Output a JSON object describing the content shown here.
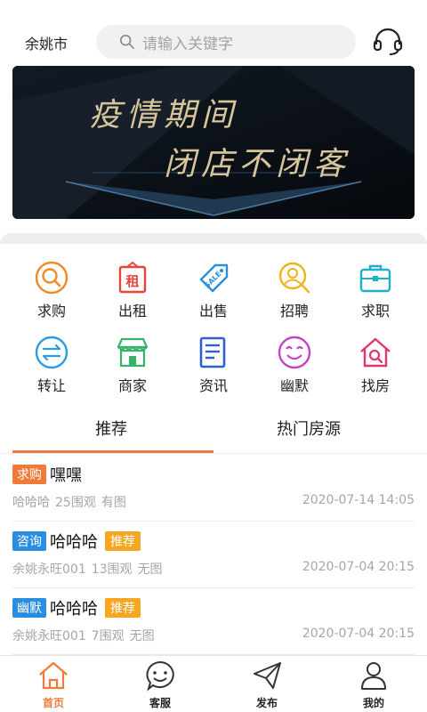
{
  "header": {
    "city": "余姚市",
    "search_placeholder": "请输入关键字"
  },
  "banner": {
    "line1": "疫情期间",
    "line2": "闭店不闭客"
  },
  "categories": [
    {
      "label": "求购",
      "icon": "magnifier-circle-icon",
      "color": "#f08a24"
    },
    {
      "label": "出租",
      "icon": "rent-sign-icon",
      "color": "#e8443a"
    },
    {
      "label": "出售",
      "icon": "sale-tag-icon",
      "color": "#2a8ee0"
    },
    {
      "label": "招聘",
      "icon": "person-search-icon",
      "color": "#f2b21b"
    },
    {
      "label": "求职",
      "icon": "briefcase-icon",
      "color": "#1fb0c9"
    },
    {
      "label": "转让",
      "icon": "transfer-arrows-icon",
      "color": "#2a9de0"
    },
    {
      "label": "商家",
      "icon": "storefront-icon",
      "color": "#35b36a"
    },
    {
      "label": "资讯",
      "icon": "news-document-icon",
      "color": "#2c5fd3"
    },
    {
      "label": "幽默",
      "icon": "smiley-icon",
      "color": "#c541c8"
    },
    {
      "label": "找房",
      "icon": "house-search-icon",
      "color": "#e0386a"
    }
  ],
  "tabs": [
    "推荐",
    "热门房源"
  ],
  "posts": [
    {
      "tag": "求购",
      "tag_color": "#f07a3a",
      "title": "嘿嘿",
      "badge": "",
      "author": "哈哈哈",
      "views": "25围观",
      "img": "有图",
      "date": "2020-07-14 14:05"
    },
    {
      "tag": "咨询",
      "tag_color": "#2a8ee0",
      "title": "哈哈哈",
      "badge": "推荐",
      "author": "余姚永旺001",
      "views": "13围观",
      "img": "无图",
      "date": "2020-07-04 20:15"
    },
    {
      "tag": "幽默",
      "tag_color": "#2a8ee0",
      "title": "哈哈哈",
      "badge": "推荐",
      "author": "余姚永旺001",
      "views": "7围观",
      "img": "无图",
      "date": "2020-07-04 20:15"
    }
  ],
  "bottom_nav": [
    {
      "label": "首页",
      "icon": "home-icon",
      "active": true
    },
    {
      "label": "客服",
      "icon": "chat-smiley-icon",
      "active": false
    },
    {
      "label": "发布",
      "icon": "paper-plane-icon",
      "active": false
    },
    {
      "label": "我的",
      "icon": "user-icon",
      "active": false
    }
  ],
  "colors": {
    "accent": "#f07a3a",
    "badge": "#f5a623"
  }
}
